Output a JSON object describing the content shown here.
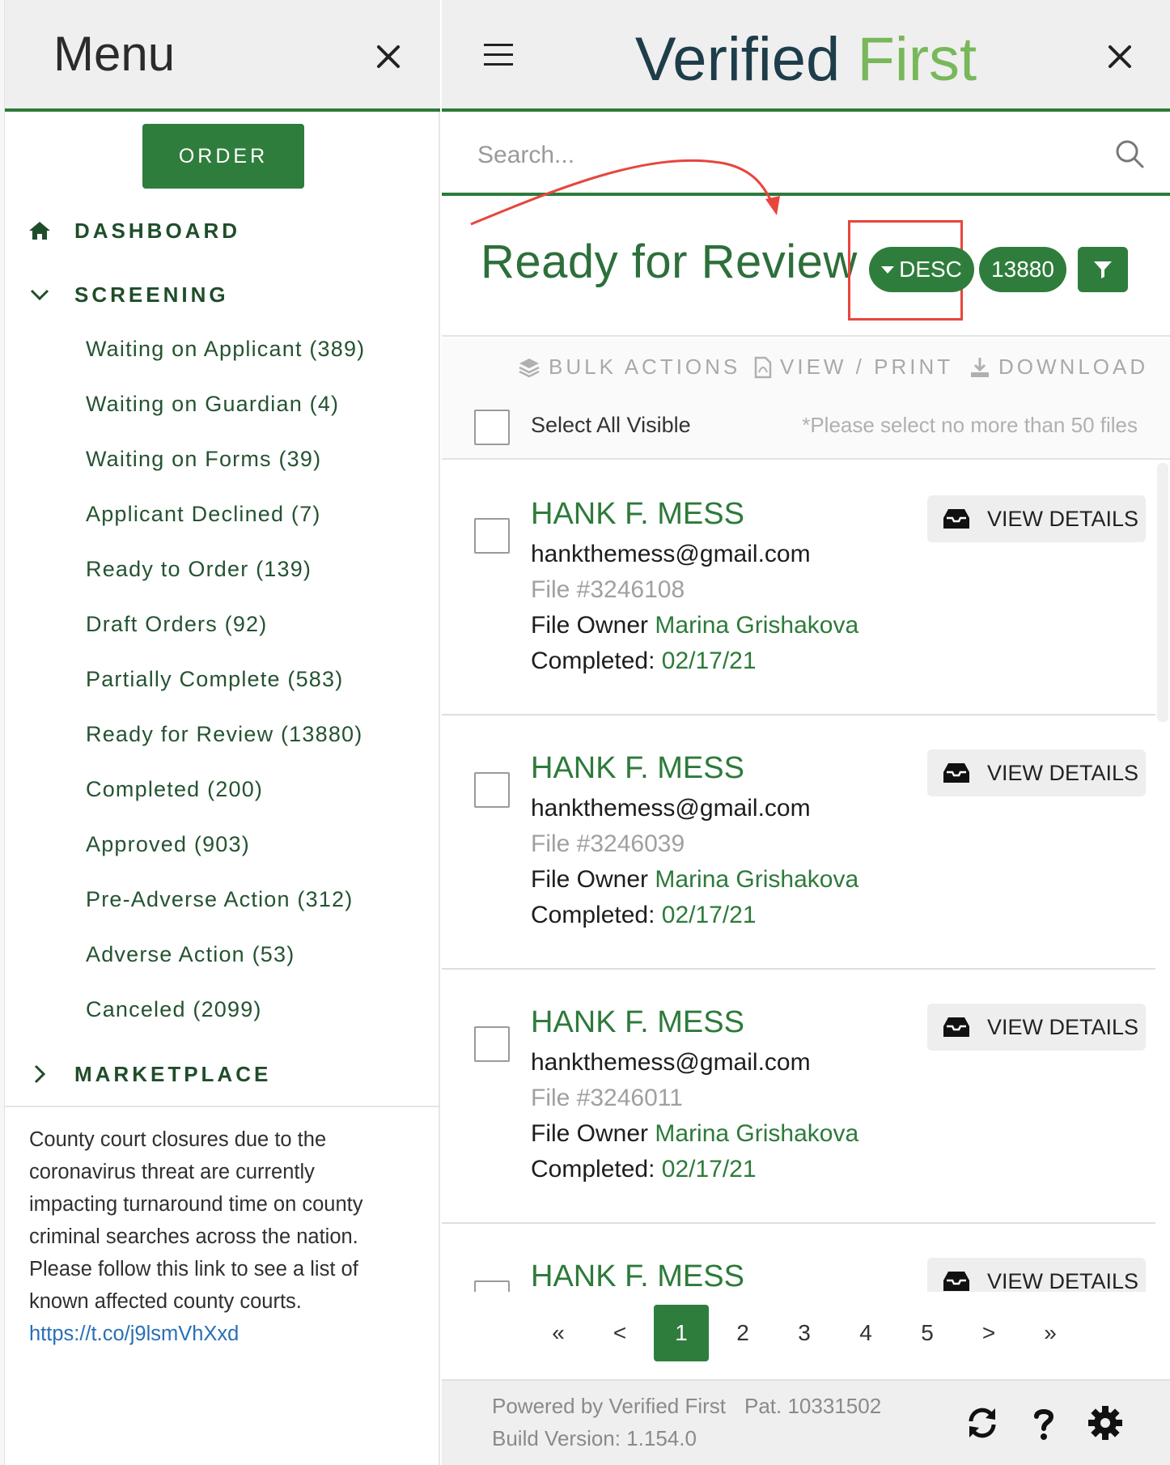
{
  "menu": {
    "title": "Menu",
    "order_label": "ORDER",
    "dashboard_label": "DASHBOARD",
    "screening_label": "SCREENING",
    "marketplace_label": "MARKETPLACE",
    "screening_items": [
      "Waiting on Applicant (389)",
      "Waiting on Guardian (4)",
      "Waiting on Forms (39)",
      "Applicant Declined (7)",
      "Ready to Order (139)",
      "Draft Orders (92)",
      "Partially Complete (583)",
      "Ready for Review (13880)",
      "Completed (200)",
      "Approved (903)",
      "Pre-Adverse Action (312)",
      "Adverse Action (53)",
      "Canceled (2099)"
    ],
    "notice_lines": [
      "County court closures due to the",
      "coronavirus threat are currently",
      "impacting turnaround time on county",
      "criminal searches across the nation.",
      "Please follow this link to see a list of",
      "known affected county courts."
    ],
    "notice_link": "https://t.co/j9lsmVhXxd"
  },
  "brand": {
    "part1": "Verified",
    "part2": "First"
  },
  "search": {
    "placeholder": "Search..."
  },
  "queue": {
    "title": "Ready for Review",
    "sort_label": "DESC",
    "count": "13880"
  },
  "actions": {
    "bulk": "BULK ACTIONS",
    "view_print": "VIEW / PRINT",
    "download": "DOWNLOAD",
    "select_all": "Select All Visible",
    "note": "*Please select no more than 50 files"
  },
  "rows": [
    {
      "name": "HANK F. MESS",
      "email": "hankthemess@gmail.com",
      "file": "File #3246108",
      "owner_label": "File Owner",
      "owner": "Marina Grishakova",
      "completed_label": "Completed:",
      "completed": "02/17/21",
      "button": "VIEW DETAILS"
    },
    {
      "name": "HANK F. MESS",
      "email": "hankthemess@gmail.com",
      "file": "File #3246039",
      "owner_label": "File Owner",
      "owner": "Marina Grishakova",
      "completed_label": "Completed:",
      "completed": "02/17/21",
      "button": "VIEW DETAILS"
    },
    {
      "name": "HANK F. MESS",
      "email": "hankthemess@gmail.com",
      "file": "File #3246011",
      "owner_label": "File Owner",
      "owner": "Marina Grishakova",
      "completed_label": "Completed:",
      "completed": "02/17/21",
      "button": "VIEW DETAILS"
    },
    {
      "name": "HANK F. MESS",
      "email": "",
      "file": "",
      "owner_label": "",
      "owner": "",
      "completed_label": "",
      "completed": "",
      "button": "VIEW DETAILS"
    }
  ],
  "pagination": {
    "first": "«",
    "prev": "<",
    "pages": [
      "1",
      "2",
      "3",
      "4",
      "5"
    ],
    "active_page": "1",
    "next": ">",
    "last": "»"
  },
  "footer": {
    "powered": "Powered by Verified First",
    "patent": "Pat. 10331502",
    "build": "Build Version: 1.154.0"
  },
  "colors": {
    "brand_green": "#2f7d3c",
    "accent_green": "#78b85a",
    "annotation_red": "#e8453c"
  },
  "icons": [
    "close-icon",
    "home-icon",
    "chevron-down-icon",
    "chevron-right-icon",
    "hamburger-icon",
    "search-icon",
    "filter-icon",
    "layers-icon",
    "pdf-file-icon",
    "download-icon",
    "inbox-icon",
    "sync-icon",
    "help-icon",
    "gear-icon"
  ]
}
